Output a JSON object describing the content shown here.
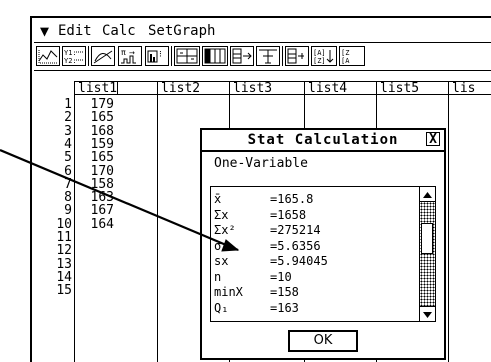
{
  "menubar": {
    "items": [
      "Edit",
      "Calc",
      "SetGraph"
    ]
  },
  "toolbar": {
    "buttons": [
      "graph-window-icon",
      "y-equals-icon",
      "conic-icon",
      "stat-calc-icon",
      "stat-graph-icon",
      "split-view-icon",
      "grid-icon",
      "sort-icon",
      "insert-row-icon",
      "insert-col-icon",
      "add-list-icon",
      "sort-asc-icon",
      "sort-desc-icon"
    ]
  },
  "table": {
    "headers": [
      "list1",
      "list2",
      "list3",
      "list4",
      "list5",
      "lis"
    ],
    "row_numbers": [
      "1",
      "2",
      "3",
      "4",
      "5",
      "6",
      "7",
      "8",
      "9",
      "10",
      "11",
      "12",
      "13",
      "14",
      "15"
    ],
    "list1": [
      "179",
      "165",
      "168",
      "159",
      "165",
      "170",
      "158",
      "163",
      "167",
      "164"
    ]
  },
  "dialog": {
    "title": "Stat Calculation",
    "close_symbol": "X",
    "subtitle": "One-Variable",
    "results": [
      {
        "label": "x̄",
        "value": "=165.8"
      },
      {
        "label": "Σx",
        "value": "=1658"
      },
      {
        "label": "Σx²",
        "value": "=275214"
      },
      {
        "label": "σx",
        "value": "=5.6356"
      },
      {
        "label": "sx",
        "value": "=5.94045"
      },
      {
        "label": "n",
        "value": "=10"
      },
      {
        "label": "minX",
        "value": "=158"
      },
      {
        "label": "Q₁",
        "value": "=163"
      }
    ],
    "ok_label": "OK"
  }
}
